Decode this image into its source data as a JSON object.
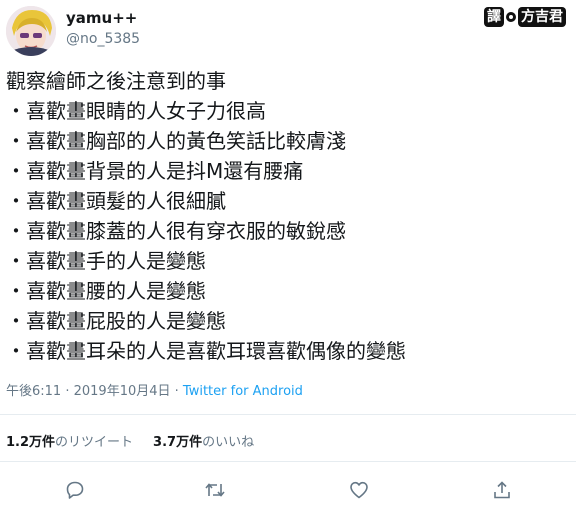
{
  "user": {
    "display_name": "yamu++",
    "handle": "@no_5385"
  },
  "watermark": {
    "box1": "譯",
    "box2": "方吉君"
  },
  "tweet": {
    "lines": [
      "觀察繪師之後注意到的事",
      "・喜歡畫眼睛的人女子力很高",
      "・喜歡畫胸部的人的黃色笑話比較膚淺",
      "・喜歡畫背景的人是抖M還有腰痛",
      "・喜歡畫頭髮的人很細膩",
      "・喜歡畫膝蓋的人很有穿衣服的敏銳感",
      "・喜歡畫手的人是變態",
      "・喜歡畫腰的人是變態",
      "・喜歡畫屁股的人是變態",
      "・喜歡畫耳朵的人是喜歡耳環喜歡偶像的變態"
    ]
  },
  "meta": {
    "time": "午後6:11",
    "separator": " · ",
    "date": "2019年10月4日",
    "source": "Twitter for Android"
  },
  "stats": {
    "retweets_count": "1.2万件",
    "retweets_label": "のリツイート",
    "likes_count": "3.7万件",
    "likes_label": "のいいね"
  },
  "actions": {
    "icons": [
      "reply-icon",
      "retweet-icon",
      "like-icon",
      "share-icon"
    ]
  },
  "colors": {
    "text": "#14171a",
    "secondary": "#657786",
    "link": "#1da1f2",
    "divider": "#e6ecf0"
  }
}
